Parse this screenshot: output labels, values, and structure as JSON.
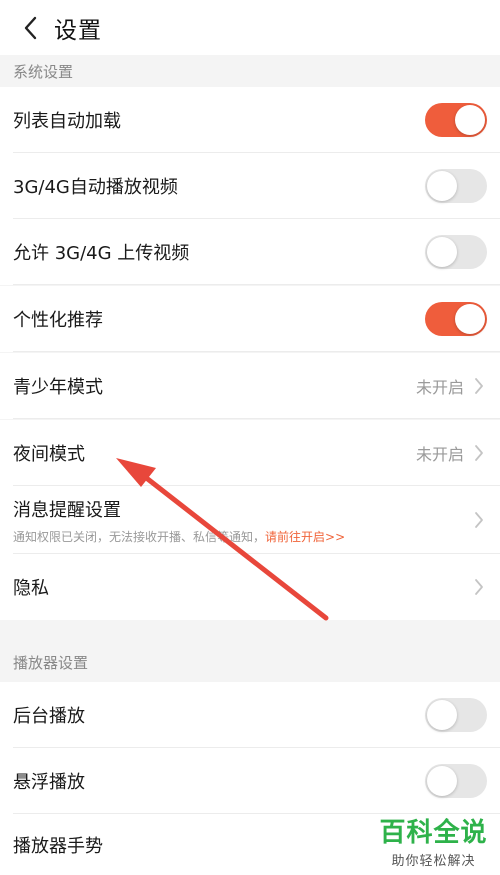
{
  "header": {
    "title": "设置",
    "back_icon": "chevron-left-icon"
  },
  "system_section": {
    "title": "系统设置",
    "rows": [
      {
        "label": "列表自动加载",
        "toggle": true
      },
      {
        "label": "3G/4G自动播放视频",
        "toggle": false
      },
      {
        "label": "允许 3G/4G 上传视频",
        "toggle": false
      },
      {
        "label": "个性化推荐",
        "toggle": true
      },
      {
        "label": "青少年模式",
        "value": "未开启"
      },
      {
        "label": "夜间模式",
        "value": "未开启"
      },
      {
        "label": "消息提醒设置",
        "sub": "通知权限已关闭，无法接收开播、私信等通知，",
        "sub_link": "请前往开启>>"
      },
      {
        "label": "隐私"
      }
    ]
  },
  "player_section": {
    "title": "播放器设置",
    "rows": [
      {
        "label": "后台播放",
        "toggle": false
      },
      {
        "label": "悬浮播放",
        "toggle": false
      },
      {
        "label": "播放器手势"
      }
    ]
  },
  "colors": {
    "accent": "#ef5d3c",
    "toggle_off": "#e6e6e6",
    "annotation_arrow": "#e8473b",
    "watermark": "#2eb24a"
  },
  "watermark": {
    "title": "百科全说",
    "subtitle": "助你轻松解决"
  }
}
